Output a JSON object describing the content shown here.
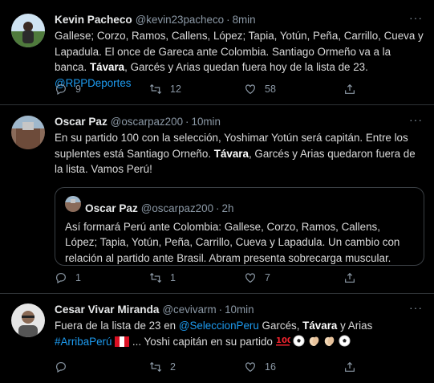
{
  "tweets": [
    {
      "name": "Kevin Pacheco",
      "handle": "@kevin23pacheco",
      "time": "8min",
      "text_1": "Gallese; Corzo, Ramos, Callens, López; Tapia, Yotún, Peña, Carrillo, Cueva y Lapadula. El once de Gareca ante Colombia. Santiago Ormeño va a la banca.",
      "bold_1": "Távara",
      "text_2": ", Garcés y Arias quedan fuera hoy de la lista de 23.",
      "mention": "@RPPDeportes",
      "replies": "9",
      "retweets": "12",
      "likes": "58"
    },
    {
      "name": "Oscar Paz",
      "handle": "@oscarpaz200",
      "time": "10min",
      "text_1": "En su partido 100 con la selección, Yoshimar Yotún será capitán. Entre los suplentes está Santiago Orneño.",
      "bold_1": "Távara",
      "text_2": ", Garcés y Arias quedaron fuera de la lista. Vamos Perú!",
      "quote": {
        "name": "Oscar Paz",
        "handle": "@oscarpaz200",
        "time": "2h",
        "text": "Así formará Perú ante Colombia: Gallese, Corzo, Ramos, Callens, López; Tapia, Yotún, Peña, Carrillo, Cueva y Lapadula. Un cambio con relación al partido ante Brasil. Abram presenta sobrecarga muscular."
      },
      "replies": "1",
      "retweets": "1",
      "likes": "7"
    },
    {
      "name": "Cesar Vivar Miranda",
      "handle": "@cevivarm",
      "time": "10min",
      "text_1": "Fuera de la lista de 23 en",
      "mention": "@SeleccionPeru",
      "text_2": "Garcés,",
      "bold_1": "Távara",
      "text_3": "y Arias",
      "hashtag": "#ArribaPerú",
      "text_4": "... Yoshi capitán en su partido",
      "replies": "",
      "retweets": "2",
      "likes": "16"
    }
  ],
  "colors": {
    "background": "#000000",
    "text": "#d9d9d9",
    "secondary": "#8b98a5",
    "link": "#1d9bf0",
    "divider": "#2f3336"
  },
  "icons": [
    "reply-icon",
    "retweet-icon",
    "like-icon",
    "share-icon",
    "more-icon",
    "peru-flag-icon",
    "hundred-points-icon",
    "soccer-ball-icon",
    "clapping-hands-icon"
  ]
}
